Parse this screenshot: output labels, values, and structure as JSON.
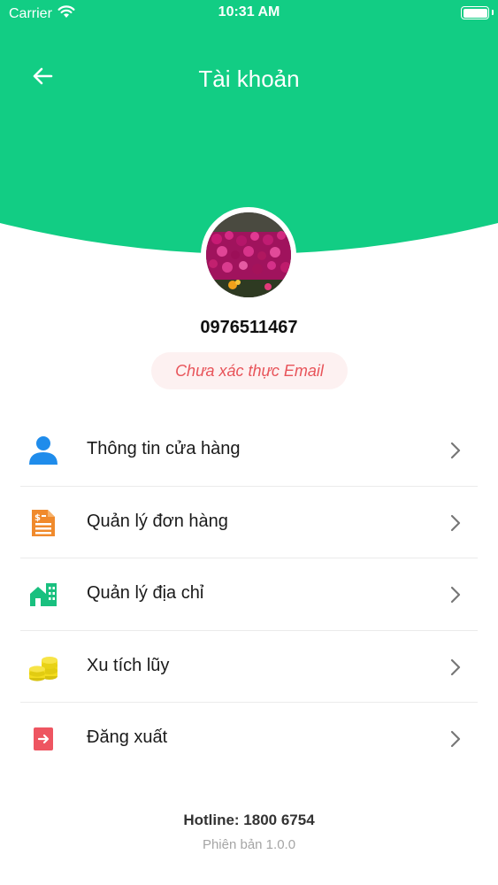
{
  "colors": {
    "brand": "#12cd84",
    "error_text": "#e8545a",
    "error_bg": "#fdf1f1"
  },
  "status_bar": {
    "carrier": "Carrier",
    "time": "10:31 AM",
    "wifi_icon": "wifi-icon",
    "battery_icon": "battery-icon"
  },
  "nav": {
    "back_icon": "arrow-left-icon",
    "title": "Tài khoản"
  },
  "profile": {
    "avatar_icon": "flower-photo",
    "phone": "0976511467",
    "verify_status": "Chưa xác thực Email"
  },
  "menu": {
    "items": [
      {
        "label": "Thông tin cửa hàng",
        "icon": "user-icon"
      },
      {
        "label": "Quản lý đơn hàng",
        "icon": "invoice-icon"
      },
      {
        "label": "Quản lý địa chỉ",
        "icon": "building-icon"
      },
      {
        "label": "Xu tích lũy",
        "icon": "coins-icon"
      },
      {
        "label": "Đăng xuất",
        "icon": "logout-icon"
      }
    ],
    "chevron_icon": "chevron-right-icon"
  },
  "footer": {
    "hotline": "Hotline: 1800 6754",
    "version": "Phiên bản 1.0.0"
  }
}
